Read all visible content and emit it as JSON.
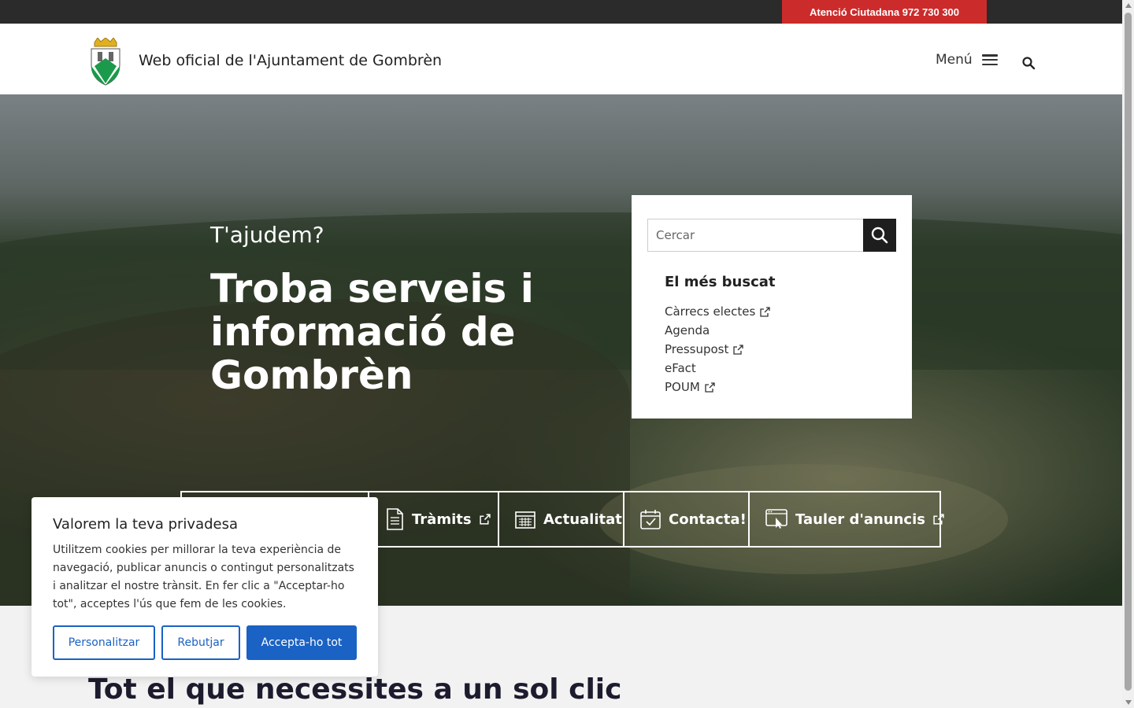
{
  "topbar": {
    "attention_label": "Atenció Ciutadana 972 730 300",
    "accent": "#cc2b2b"
  },
  "header": {
    "site_title": "Web oficial de l'Ajuntament de Gombrèn",
    "menu_label": "Menú",
    "crest_icon": "coat-of-arms-icon"
  },
  "hero": {
    "kicker": "T'ajudem?",
    "title": "Troba serveis i informació de Gombrèn"
  },
  "search": {
    "placeholder": "Cercar",
    "popular_title": "El més buscat",
    "popular": [
      {
        "label": "Càrrecs electes",
        "external": true
      },
      {
        "label": "Agenda",
        "external": false
      },
      {
        "label": "Pressupost",
        "external": true
      },
      {
        "label": "eFact",
        "external": false
      },
      {
        "label": "POUM",
        "external": true
      }
    ]
  },
  "quicklinks": [
    {
      "label": "Tràmits",
      "icon": "document-icon",
      "external": true
    },
    {
      "label": "Actualitat",
      "icon": "calendar-grid-icon",
      "external": false
    },
    {
      "label": "Contacta!",
      "icon": "calendar-check-icon",
      "external": false
    },
    {
      "label": "Tauler d'anuncis",
      "icon": "browser-click-icon",
      "external": true
    }
  ],
  "cookie": {
    "title": "Valorem la teva privadesa",
    "text": "Utilitzem cookies per millorar la teva experiència de navegació, publicar anuncis o contingut personalitzats i analitzar el nostre trànsit. En fer clic a \"Acceptar-ho tot\", acceptes l'ús que fem de les cookies.",
    "customize_label": "Personalitzar",
    "reject_label": "Rebutjar",
    "accept_label": "Accepta-ho tot",
    "button_color": "#1a62c4"
  },
  "section": {
    "title": "Tot el que necessites a un sol clic"
  }
}
